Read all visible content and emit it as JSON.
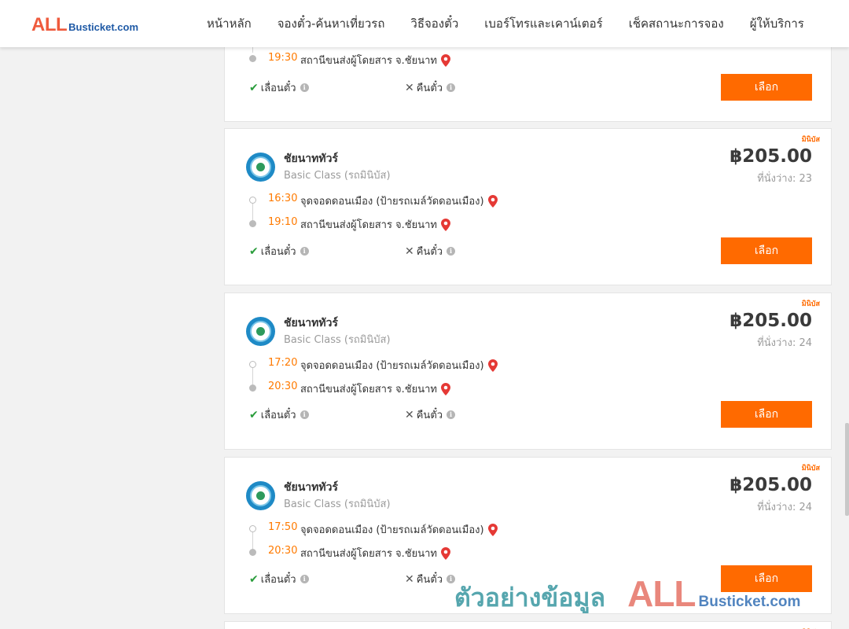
{
  "header": {
    "logo_all": "ALL",
    "logo_busticket": "Busticket.com",
    "nav": [
      "หน้าหลัก",
      "จองตั๋ว-ค้นหาเที่ยวรถ",
      "วิธีจองตั๋ว",
      "เบอร์โทรและเคาน์เตอร์",
      "เช็คสถานะการจอง",
      "ผู้ให้บริการ"
    ]
  },
  "labels": {
    "reschedule": "เลื่อนตั๋ว",
    "refund": "คืนตั๋ว",
    "select": "เลือก",
    "badge": "มินิบัส"
  },
  "partial_card": {
    "arrive_time": "19:30",
    "arrive_place": "สถานีขนส่งผู้โดยสาร จ.ชัยนาท"
  },
  "trips": [
    {
      "operator": "ชัยนาททัวร์",
      "class": "Basic Class (รถมินิบัส)",
      "price": "฿205.00",
      "seats": "ที่นั่งว่าง: 23",
      "depart_time": "16:30",
      "depart_place": "จุดจอดดอนเมือง (ป้ายรถเมล์วัดดอนเมือง)",
      "arrive_time": "19:10",
      "arrive_place": "สถานีขนส่งผู้โดยสาร จ.ชัยนาท"
    },
    {
      "operator": "ชัยนาททัวร์",
      "class": "Basic Class (รถมินิบัส)",
      "price": "฿205.00",
      "seats": "ที่นั่งว่าง: 24",
      "depart_time": "17:20",
      "depart_place": "จุดจอดดอนเมือง (ป้ายรถเมล์วัดดอนเมือง)",
      "arrive_time": "20:30",
      "arrive_place": "สถานีขนส่งผู้โดยสาร จ.ชัยนาท"
    },
    {
      "operator": "ชัยนาททัวร์",
      "class": "Basic Class (รถมินิบัส)",
      "price": "฿205.00",
      "seats": "ที่นั่งว่าง: 24",
      "depart_time": "17:50",
      "depart_place": "จุดจอดดอนเมือง (ป้ายรถเมล์วัดดอนเมือง)",
      "arrive_time": "20:30",
      "arrive_place": "สถานีขนส่งผู้โดยสาร จ.ชัยนาท"
    }
  ],
  "watermark": {
    "text": "ตัวอย่างข้อมูล",
    "all": "ALL",
    "busticket": "Busticket.com"
  },
  "colors": {
    "accent": "#ff6a00",
    "time": "#ff7a00",
    "check": "#2a9d3c",
    "pin": "#e53935"
  }
}
